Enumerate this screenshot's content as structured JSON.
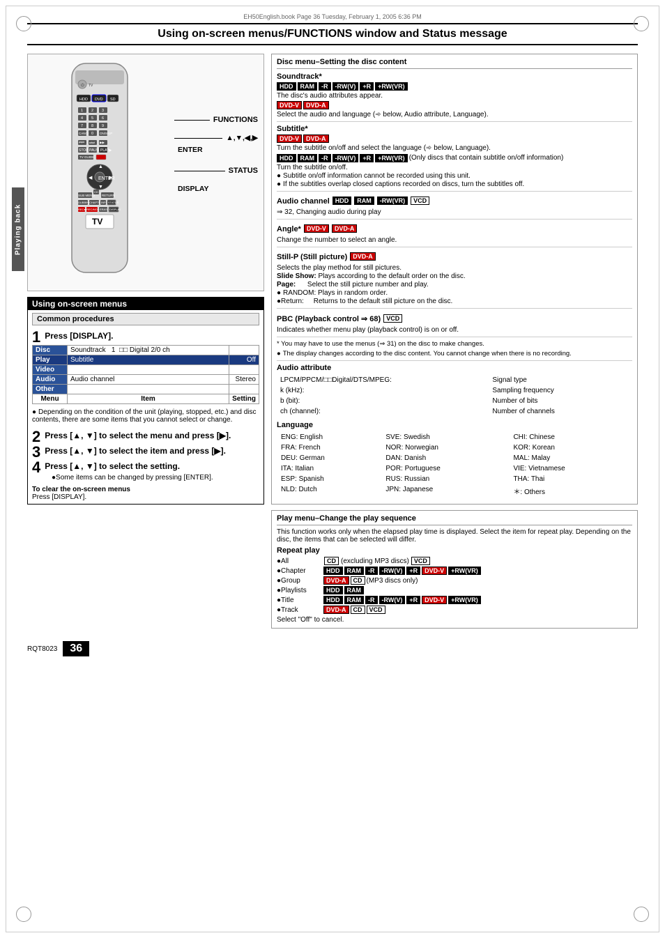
{
  "page": {
    "title": "Using on-screen menus/FUNCTIONS window and Status message",
    "file_info": "EH50English.book  Page 36  Tuesday, February 1, 2005  6:36 PM",
    "page_number": "36",
    "doc_code": "RQT8023"
  },
  "left": {
    "section_title": "Using on-screen menus",
    "common_procedures": "Common procedures",
    "steps": [
      {
        "num": "1",
        "text": "Press [DISPLAY]."
      },
      {
        "num": "2",
        "text": "Press [▲, ▼] to select the menu and press [▶]."
      },
      {
        "num": "3",
        "text": "Press [▲, ▼] to select the item and press [▶]."
      },
      {
        "num": "4",
        "text": "Press [▲, ▼] to select the setting.",
        "sub": "●Some items can be changed by pressing [ENTER]."
      }
    ],
    "menu_table": {
      "columns": [
        "Menu",
        "Item",
        "Setting"
      ],
      "rows": [
        {
          "menu": "Disc",
          "item": "Soundtrack",
          "setting": "1  DD Digital  2/0 ch",
          "highlight_menu": false,
          "highlight_item": false
        },
        {
          "menu": "Play",
          "item": "Subtitle",
          "setting": "Off",
          "highlight_menu": true,
          "highlight_item": false
        },
        {
          "menu": "Video",
          "item": "",
          "setting": "",
          "highlight_menu": false
        },
        {
          "menu": "Audio",
          "item": "Audio channel",
          "setting": "Stereo",
          "highlight_menu": false
        },
        {
          "menu": "Other",
          "item": "",
          "setting": "",
          "highlight_menu": false
        }
      ]
    },
    "note_text": "●Depending on the condition of the unit (playing, stopped, etc.) and disc contents, there are some items that you cannot select or change.",
    "clear_note_title": "To clear the on-screen menus",
    "clear_note_text": "Press [DISPLAY].",
    "functions_label": "FUNCTIONS",
    "arrows_label": "▲,▼,◀,▶",
    "enter_label": "ENTER",
    "status_label": "STATUS",
    "display_label": "DISPLAY",
    "playing_back_label": "Playing back"
  },
  "right": {
    "disc_menu_section": {
      "title": "Disc menu–Setting the disc content",
      "soundtrack": {
        "title": "Soundtrack*",
        "badges_line1": [
          "HDD",
          "RAM",
          "-R",
          "-RW(V)",
          "+R",
          "+RW(VR)"
        ],
        "text1": "The disc's audio attributes appear.",
        "badges_line2": [
          "DVD-V",
          "DVD-A"
        ],
        "text2": "Select the audio and language (➾ below, Audio attribute, Language)."
      },
      "subtitle": {
        "title": "Subtitle*",
        "badges_line1": [
          "DVD-V",
          "DVD-A"
        ],
        "text1": "Turn the subtitle on/off and select the language (➾ below, Language).",
        "badges_line2": [
          "HDD",
          "RAM",
          "-R",
          "-RW(V)",
          "+R",
          "+RW(VR)"
        ],
        "text2": "(Only discs that contain subtitle on/off information)",
        "text3": "Turn the subtitle on/off.",
        "bullets": [
          "Subtitle on/off information cannot be recorded using this unit.",
          "If the subtitles overlap closed captions recorded on discs, turn the subtitles off."
        ]
      },
      "audio_channel": {
        "title": "Audio channel",
        "badges": [
          "HDD",
          "RAM",
          "-RW(VR)",
          "VCD"
        ],
        "text": "⇒ 32, Changing audio during play"
      },
      "angle": {
        "title": "Angle*",
        "badges": [
          "DVD-V",
          "DVD-A"
        ],
        "text": "Change the number to select an angle."
      },
      "still_p": {
        "title": "Still-P (Still picture)",
        "badges": [
          "DVD-A"
        ],
        "text1": "Selects the play method for still pictures.",
        "slide_show": "Slide Show: Plays according to the default order on the disc.",
        "page": "Page:      Select the still picture number and play.",
        "random": "●RANDOM: Plays in random order.",
        "return_text": "●Return:      Returns to the default still picture on the disc."
      },
      "pbc": {
        "title": "PBC (Playback control ⇒ 68)",
        "badges": [
          "VCD"
        ],
        "text": "Indicates whether menu play (playback control) is on or off."
      },
      "footnotes": [
        "* You may have to use the menus (⇒ 31) on the disc to make changes.",
        "●The display changes according to the disc content. You cannot change when there is no recording."
      ],
      "audio_attribute": {
        "title": "Audio attribute",
        "rows": [
          {
            "left": "LPCM/PPCM/DDDigital/DTS/MPEG:",
            "right": "Signal type"
          },
          {
            "left": "k (kHz):",
            "right": "Sampling frequency"
          },
          {
            "left": "b (bit):",
            "right": "Number of bits"
          },
          {
            "left": "ch (channel):",
            "right": "Number of channels"
          }
        ]
      },
      "language": {
        "title": "Language",
        "entries": [
          [
            "ENG: English",
            "SVE: Swedish",
            "CHI: Chinese"
          ],
          [
            "FRA: French",
            "NOR: Norwegian",
            "KOR: Korean"
          ],
          [
            "DEU: German",
            "DAN: Danish",
            "MAL: Malay"
          ],
          [
            "ITA: Italian",
            "POR: Portuguese",
            "VIE: Vietnamese"
          ],
          [
            "ESP: Spanish",
            "RUS: Russian",
            "THA: Thai"
          ],
          [
            "NLD: Dutch",
            "JPN: Japanese",
            "＊:  Others"
          ]
        ]
      }
    },
    "play_menu_section": {
      "title": "Play menu–Change the play sequence",
      "description": "This function works only when the elapsed play time is displayed. Select the item for repeat play. Depending on the disc, the items that can be selected will differ.",
      "repeat_play": {
        "title": "Repeat play",
        "items": [
          {
            "label": "●All",
            "badges": [
              "CD"
            ],
            "extra": "(excluding MP3 discs)",
            "extra_badges": [
              "VCD"
            ]
          },
          {
            "label": "●Chapter",
            "badges": [
              "HDD",
              "RAM",
              "-R",
              "-RW(V)",
              "+R",
              "DVD-V",
              "+RW(VR)"
            ]
          },
          {
            "label": "●Group",
            "badges": [
              "DVD-A",
              "CD"
            ],
            "extra": "(MP3 discs only)"
          },
          {
            "label": "●Playlists",
            "badges": [
              "HDD",
              "RAM"
            ]
          },
          {
            "label": "●Title",
            "badges": [
              "HDD",
              "RAM",
              "-R",
              "-RW(V)",
              "+R",
              "DVD-V",
              "+RW(VR)"
            ]
          },
          {
            "label": "●Track",
            "badges": [
              "DVD-A",
              "CD",
              "VCD"
            ]
          }
        ],
        "cancel_text": "Select \"Off\" to cancel."
      }
    }
  }
}
